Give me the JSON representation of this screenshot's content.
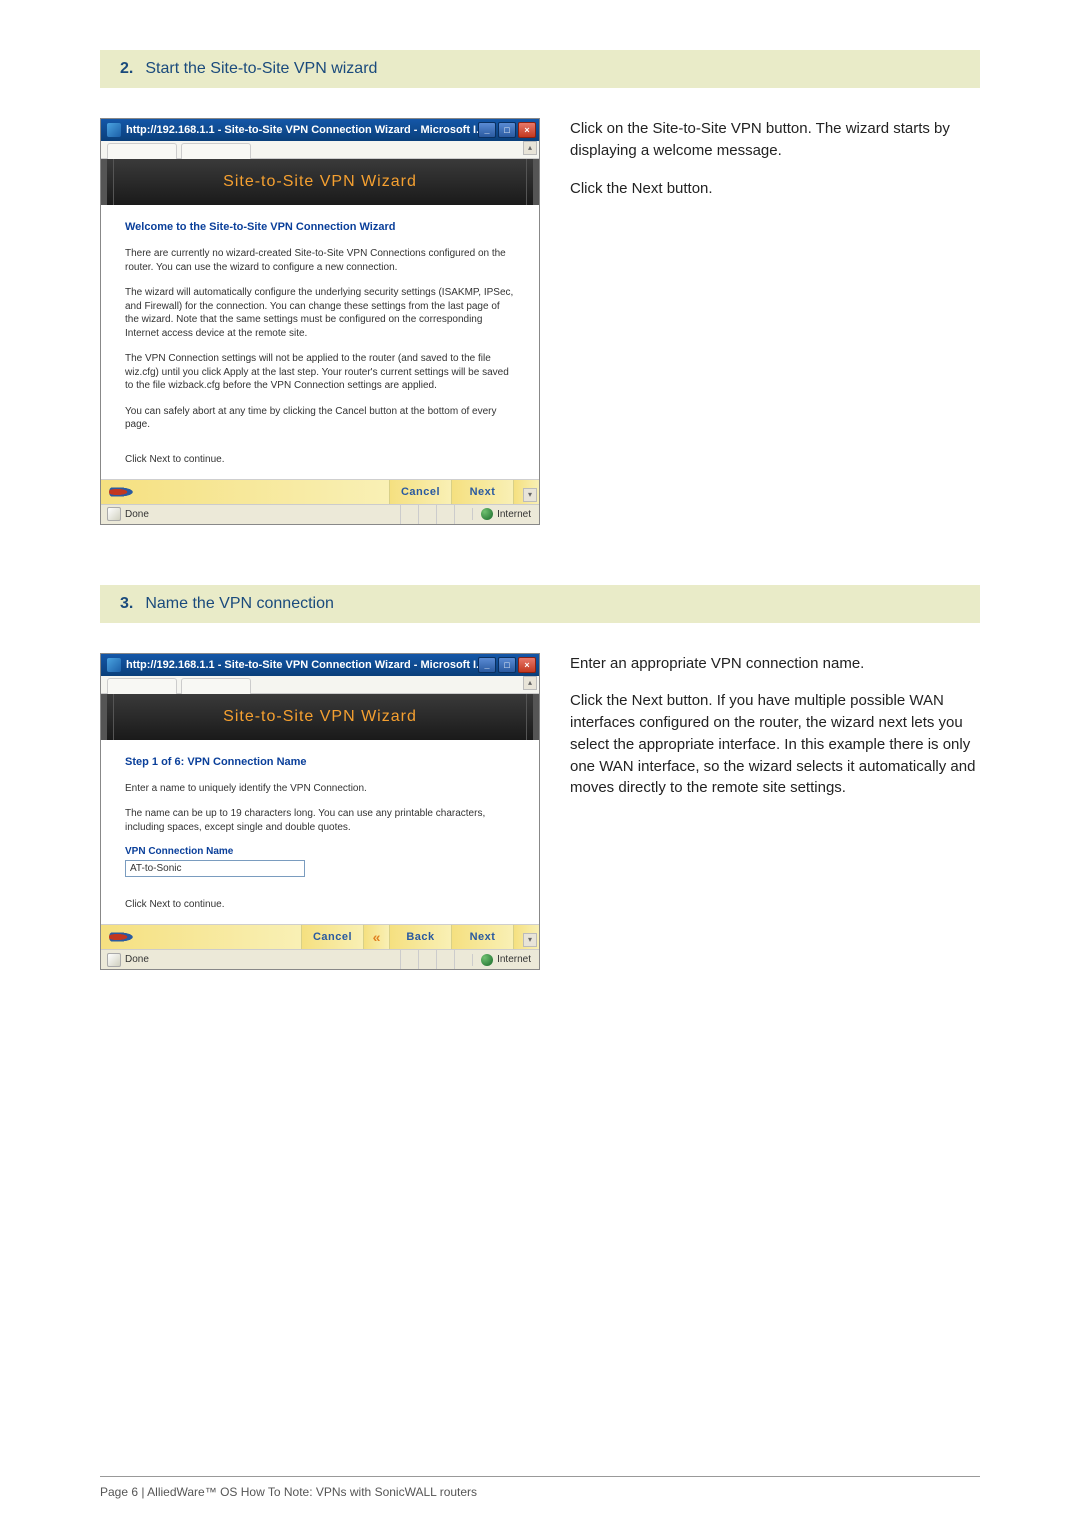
{
  "step2": {
    "number": "2.",
    "title": "Start the Site-to-Site VPN wizard",
    "window_title": "http://192.168.1.1 - Site-to-Site VPN Connection Wizard - Microsoft I...",
    "banner": "Site-to-Site  VPN  Wizard",
    "heading": "Welcome to the Site-to-Site VPN Connection Wizard",
    "para1": "There are currently no wizard-created Site-to-Site VPN Connections configured on the router. You can use the wizard to configure a new connection.",
    "para2": "The wizard will automatically configure the underlying security settings (ISAKMP, IPSec, and Firewall) for the connection. You can change these settings from the last page of the wizard. Note that the same settings must be configured on the corresponding Internet access device at the remote site.",
    "para3": "The VPN Connection settings will not be applied to the router (and saved to the file wiz.cfg) until you click Apply at the last step. Your router's current settings will be saved to the file wizback.cfg before the VPN Connection settings are applied.",
    "para4": "You can safely abort at any time by clicking the Cancel button at the bottom of every page.",
    "click_next": "Click Next to continue.",
    "btn_cancel": "Cancel",
    "btn_next": "Next",
    "status_done": "Done",
    "status_internet": "Internet",
    "instructions1": "Click on the Site-to-Site VPN button. The wizard starts by displaying a welcome message.",
    "instructions2": "Click the Next button."
  },
  "step3": {
    "number": "3.",
    "title": "Name the VPN connection",
    "window_title": "http://192.168.1.1 - Site-to-Site VPN Connection Wizard - Microsoft I...",
    "banner": "Site-to-Site  VPN  Wizard",
    "heading": "Step 1 of 6:  VPN Connection Name",
    "para1": "Enter a name to uniquely identify the VPN Connection.",
    "para2": "The name can be up to 19 characters long. You can use any printable characters, including spaces, except single and double quotes.",
    "field_label": "VPN Connection Name",
    "field_value": "AT-to-Sonic",
    "click_next": "Click Next to continue.",
    "btn_cancel": "Cancel",
    "btn_back": "Back",
    "btn_next": "Next",
    "status_done": "Done",
    "status_internet": "Internet",
    "instructions1": "Enter an appropriate VPN connection name.",
    "instructions2": "Click the Next button. If you have multiple possible WAN interfaces configured on the router, the wizard next lets you select the appropriate interface. In this example there is only one WAN interface, so the wizard selects it automatically and moves directly to the remote site settings."
  },
  "footer": "Page 6 | AlliedWare™ OS How To Note: VPNs with SonicWALL routers"
}
